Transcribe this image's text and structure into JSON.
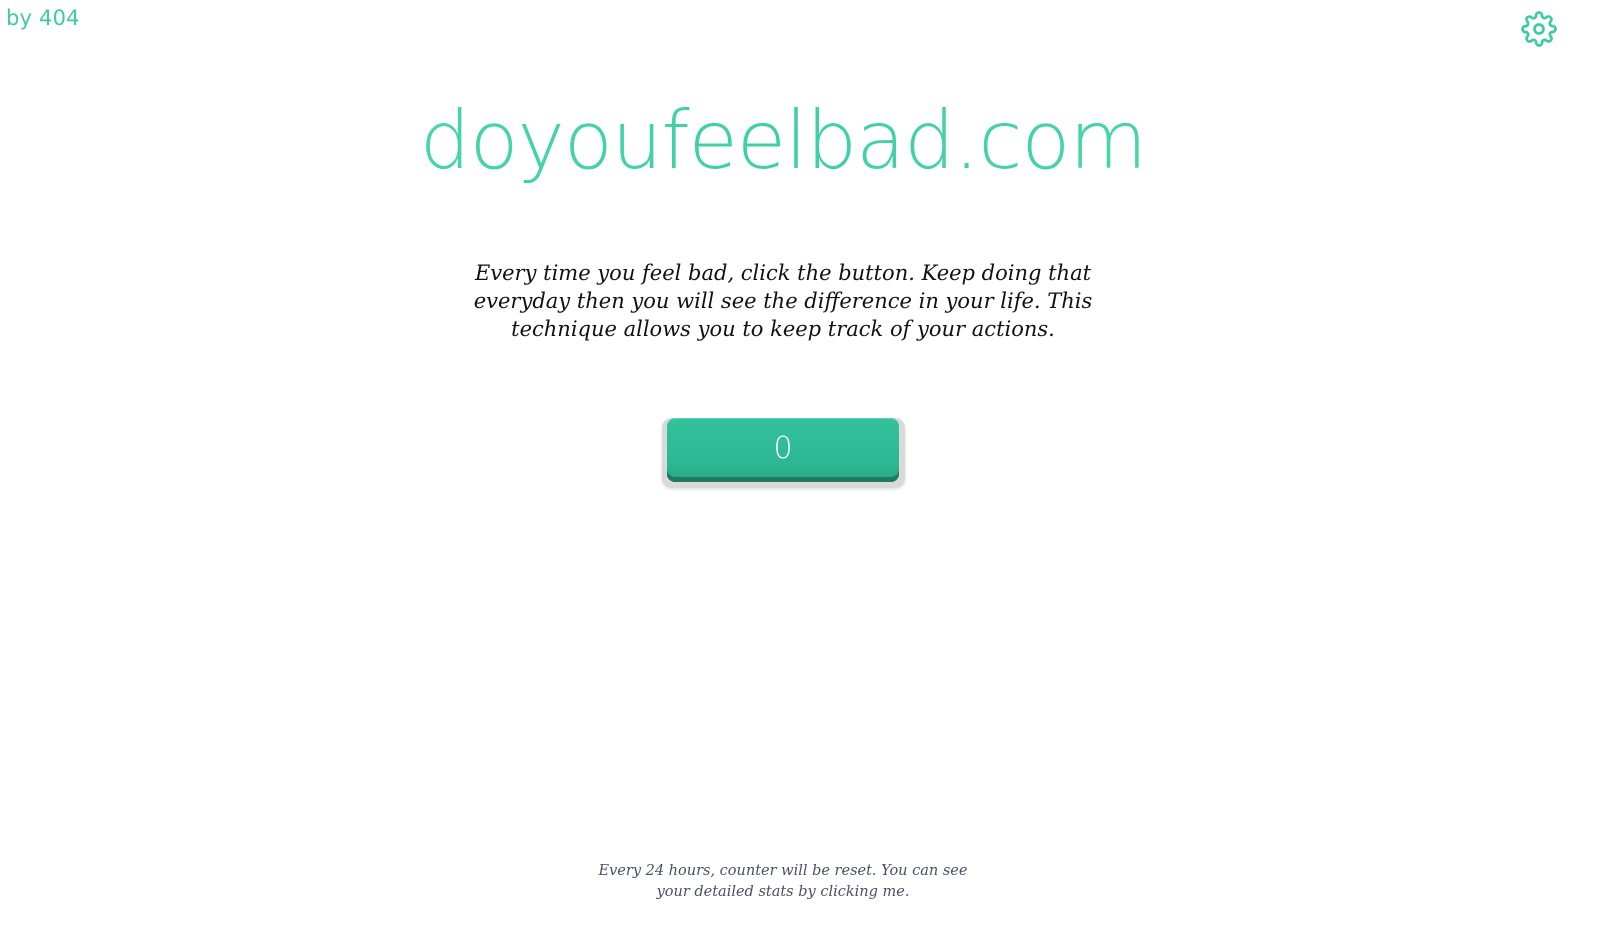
{
  "header": {
    "author_label": "by 404",
    "settings_icon": "gear-icon"
  },
  "main": {
    "site_title": "doyoufeelbad.com",
    "intro_text": "Every time you feel bad, click the button. Keep doing that everyday then you will see the difference in your life. This technique allows you to keep track of your actions.",
    "counter_value": "0"
  },
  "footer": {
    "note_text": "Every 24 hours, counter will be reset. You can see your detailed stats by clicking me."
  },
  "colors": {
    "accent": "#3ccba2",
    "button": "#2cb893",
    "button_shadow": "#1d7a60",
    "footer_text": "#4a4f66"
  }
}
